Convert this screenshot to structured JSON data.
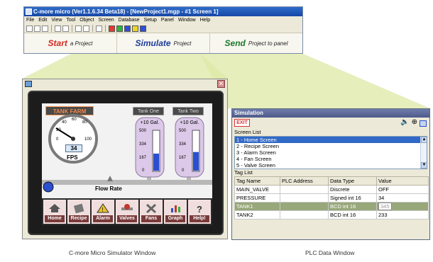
{
  "app_window": {
    "title": "C-more micro (Ver1.1.6.34 Beta18) - [NewProject1.mgp - #1 Screen 1]",
    "menu": [
      "File",
      "Edit",
      "View",
      "Tool",
      "Object",
      "Screen",
      "Database",
      "Setup",
      "Panel",
      "Window",
      "Help"
    ],
    "steps": [
      {
        "big": "Start",
        "small": "a Project",
        "color": "#d42a1f"
      },
      {
        "big": "Simulate",
        "small": "Project",
        "color": "#1c3c9c"
      },
      {
        "big": "Send",
        "small": "Project to panel",
        "color": "#1a7a2a"
      }
    ],
    "toolbar_colors": [
      "#e23b2f",
      "#2fb53b",
      "#2f4fd5",
      "#e8d62e",
      "#2f4fd5"
    ]
  },
  "simulator": {
    "tank_farm_label": "TANK FARM",
    "tank_one_label": "Tank One",
    "tank_two_label": "Tank Two",
    "gauge_ticks": [
      "40",
      "60",
      "80",
      "20",
      "0",
      "100"
    ],
    "gauge_value": "34",
    "gauge_units": "FPS",
    "flow_rate_label": "Flow Rate",
    "tank_capacity": "+10 Gal.",
    "tank_scale": [
      "500",
      "334",
      "167",
      "0"
    ],
    "tank_one_level": 0.43,
    "tank_two_level": 0.47,
    "nav_buttons": [
      "Home",
      "Recipe",
      "Alarm",
      "Valves",
      "Fans",
      "Graph",
      "Help!"
    ]
  },
  "plc_window": {
    "title": "Simulation",
    "exit_label": "EXIT",
    "screen_list_label": "Screen List",
    "screens": [
      "1 - Home Screen",
      "2 - Recipe Screen",
      "3 - Alarm Screen",
      "4 - Fan Screen",
      "5 - Valve Screen"
    ],
    "selected_screen": 0,
    "tag_list_label": "Tag List",
    "columns": [
      "Tag Name",
      "PLC Address",
      "Data Type",
      "Value"
    ],
    "rows": [
      {
        "name": "MAIN_VALVE",
        "address": "",
        "type": "Discrete",
        "value": "OFF"
      },
      {
        "name": "PRESSURE",
        "address": "",
        "type": "Signed int 16",
        "value": "34"
      },
      {
        "name": "TANK1",
        "address": "",
        "type": "BCD int 16",
        "value": "345"
      },
      {
        "name": "TANK2",
        "address": "",
        "type": "BCD int 16",
        "value": "233"
      }
    ],
    "highlighted_row": 2
  },
  "captions": {
    "simulator": "C-more Micro Simulator Window",
    "plc": "PLC Data Window"
  }
}
